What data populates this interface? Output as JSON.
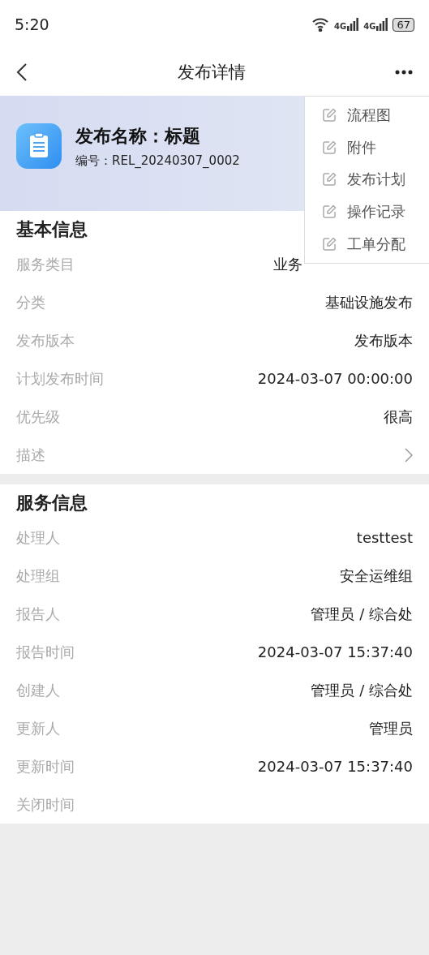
{
  "status_bar": {
    "time": "5:20",
    "network_1": "4G",
    "network_2": "4G",
    "battery": "67"
  },
  "nav": {
    "title": "发布详情"
  },
  "header": {
    "title": "发布名称：标题",
    "number": "编号：REL_20240307_0002"
  },
  "menu": [
    {
      "label": "流程图"
    },
    {
      "label": "附件"
    },
    {
      "label": "发布计划"
    },
    {
      "label": "操作记录"
    },
    {
      "label": "工单分配"
    }
  ],
  "sections": [
    {
      "title": "基本信息",
      "rows": [
        {
          "kind": "covered",
          "label": "服务类目",
          "value": "业务"
        },
        {
          "kind": "text",
          "label": "分类",
          "value": "基础设施发布"
        },
        {
          "kind": "text",
          "label": "发布版本",
          "value": "发布版本"
        },
        {
          "kind": "text",
          "label": "计划发布时间",
          "value": "2024-03-07 00:00:00"
        },
        {
          "kind": "text",
          "label": "优先级",
          "value": "很高"
        },
        {
          "kind": "link",
          "label": "描述"
        }
      ]
    },
    {
      "title": "服务信息",
      "rows": [
        {
          "kind": "text",
          "label": "处理人",
          "value": "testtest"
        },
        {
          "kind": "text",
          "label": "处理组",
          "value": "安全运维组"
        },
        {
          "kind": "text",
          "label": "报告人",
          "value": "管理员 / 综合处"
        },
        {
          "kind": "text",
          "label": "报告时间",
          "value": "2024-03-07 15:37:40"
        },
        {
          "kind": "text",
          "label": "创建人",
          "value": "管理员 / 综合处"
        },
        {
          "kind": "text",
          "label": "更新人",
          "value": "管理员"
        },
        {
          "kind": "text",
          "label": "更新时间",
          "value": "2024-03-07 15:37:40"
        },
        {
          "kind": "text",
          "label": "关闭时间"
        }
      ]
    }
  ]
}
